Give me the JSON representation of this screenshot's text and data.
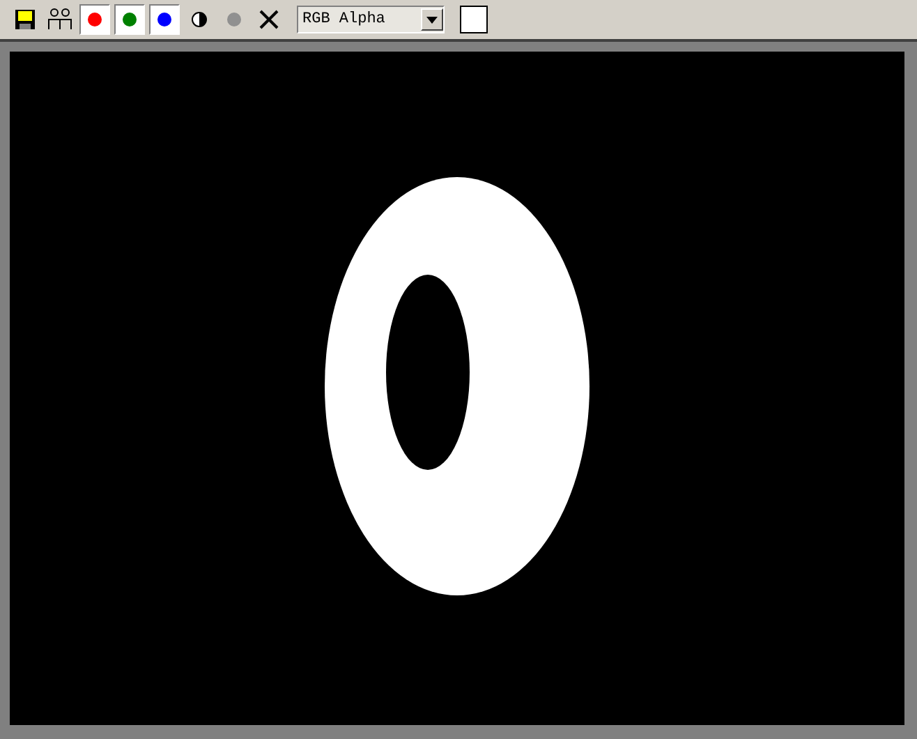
{
  "toolbar": {
    "channels": [
      {
        "color": "#ff0000",
        "on": true
      },
      {
        "color": "#008000",
        "on": true
      },
      {
        "color": "#0000ff",
        "on": true
      }
    ],
    "alpha_toggle": {
      "on": false
    },
    "display_dropdown": {
      "value": "RGB Alpha"
    },
    "swatch": {
      "color": "#ffffff"
    }
  }
}
